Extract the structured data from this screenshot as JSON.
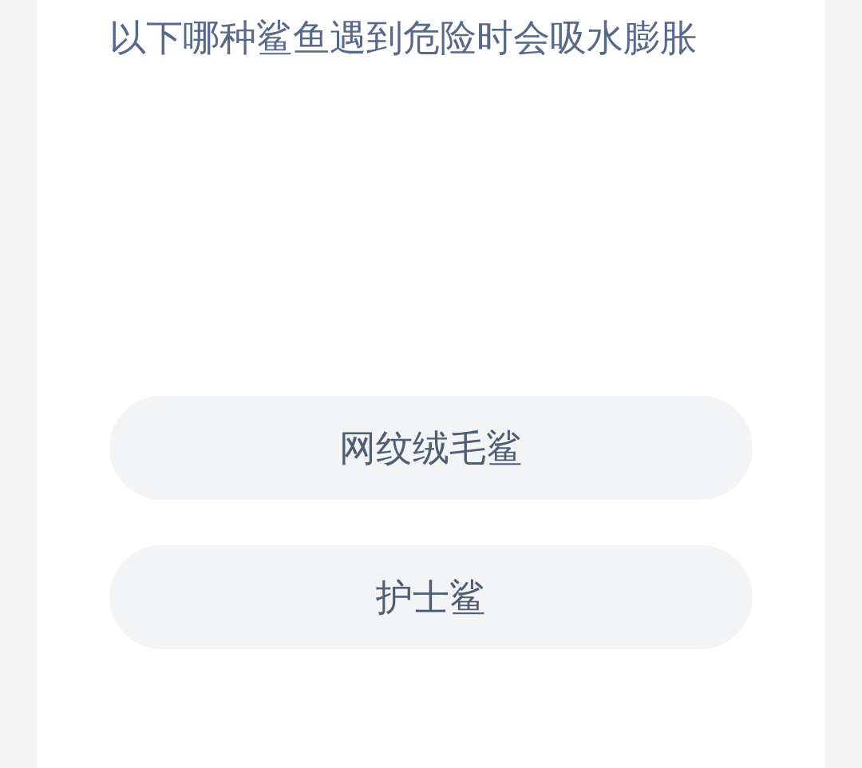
{
  "question": "以下哪种鲨鱼遇到危险时会吸水膨胀",
  "options": [
    {
      "label": "网纹绒毛鲨"
    },
    {
      "label": "护士鲨"
    }
  ]
}
